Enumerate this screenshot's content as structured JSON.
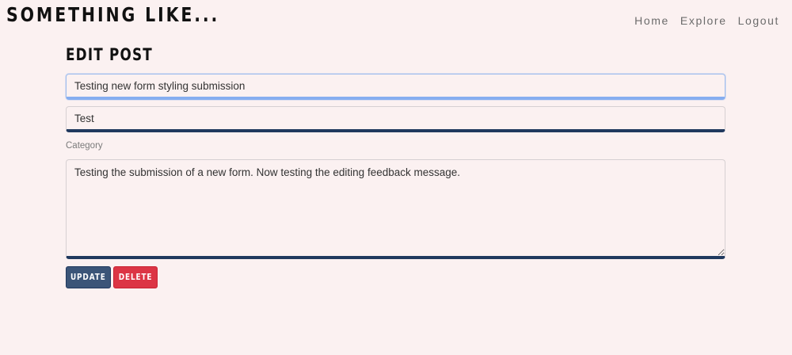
{
  "navbar": {
    "brand": "SOMETHING LIKE...",
    "links": [
      "Home",
      "Explore",
      "Logout"
    ]
  },
  "page": {
    "title": "EDIT POST"
  },
  "form": {
    "title_value": "Testing new form styling submission",
    "category_value": "Test",
    "category_label": "Category",
    "body_value": "Testing the submission of a new form. Now testing the editing feedback message.",
    "update_label": "UPDATE",
    "delete_label": "DELETE"
  },
  "colors": {
    "background": "#fbf1f1",
    "primary": "#3b5578",
    "danger": "#dc3545",
    "focus": "#86aef0"
  }
}
